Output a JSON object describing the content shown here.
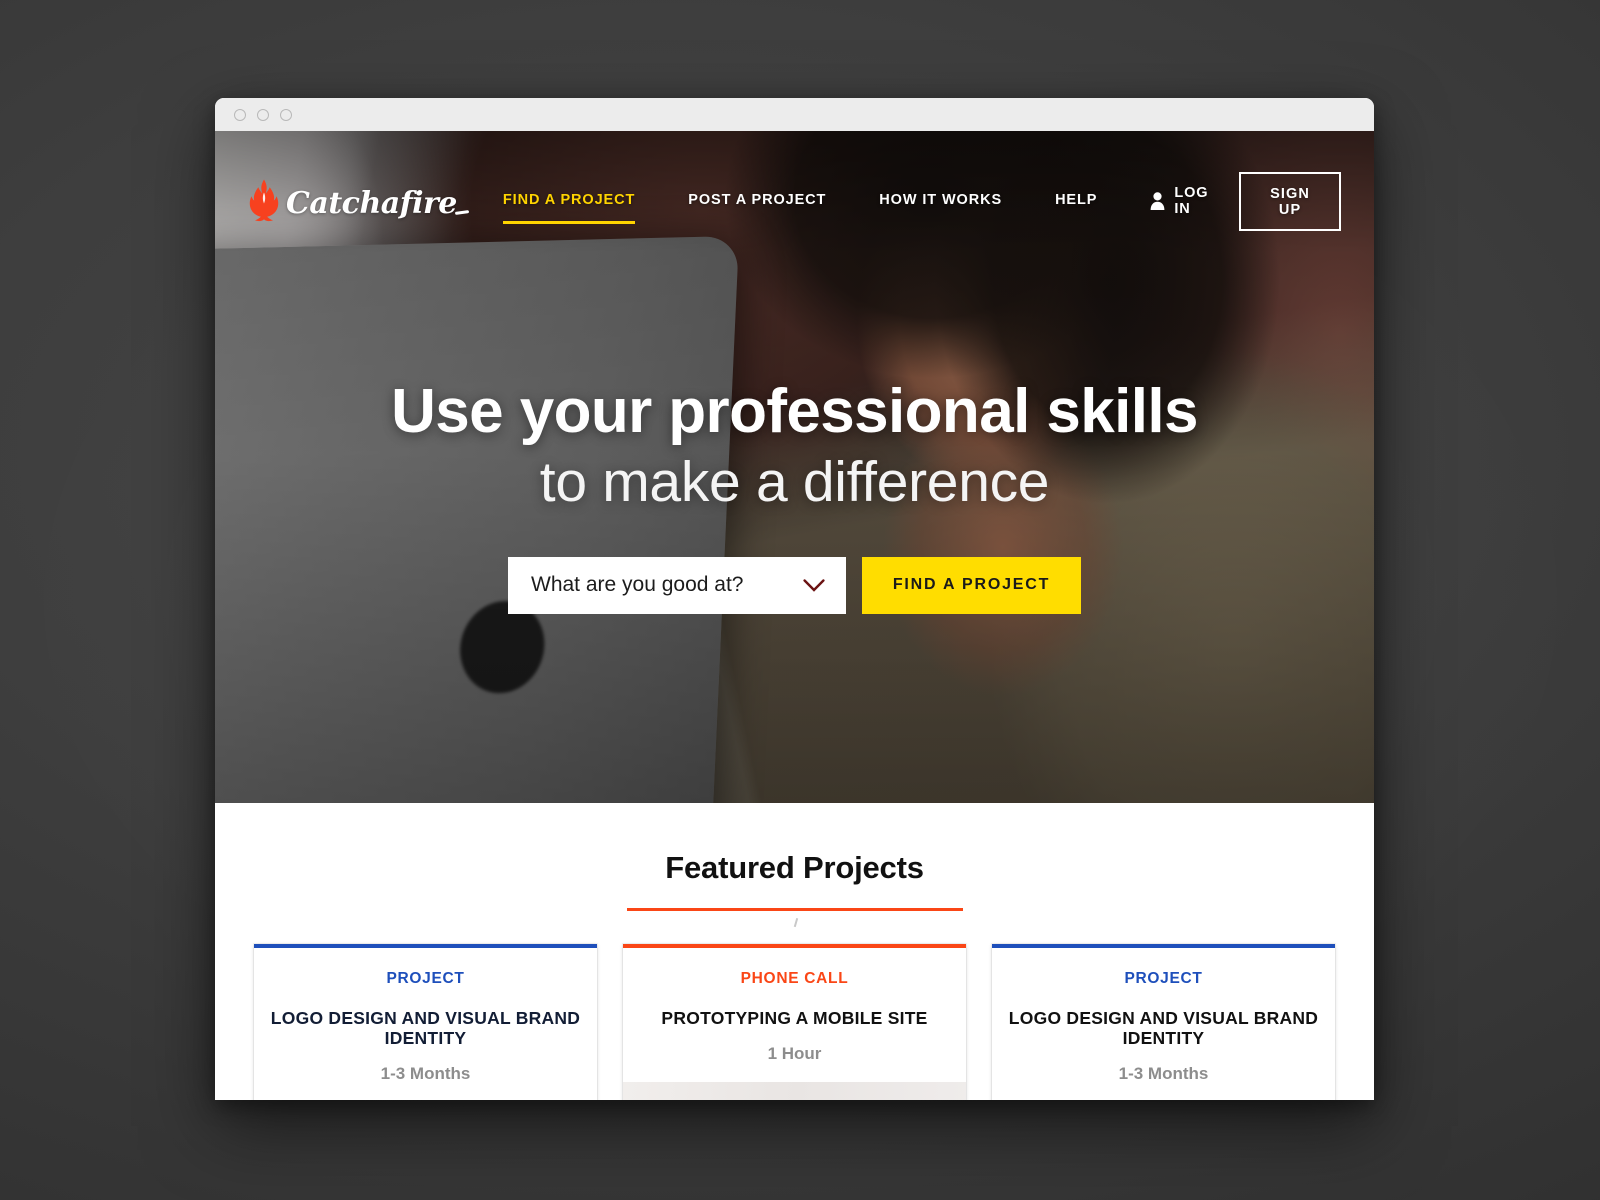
{
  "window": {
    "dots": [
      "close-dot",
      "minimize-dot",
      "maximize-dot"
    ]
  },
  "brand": {
    "name": "Catchafire",
    "flame_color": "#f7411f",
    "logo_text_color": "#ffffff"
  },
  "nav": {
    "links": [
      {
        "label": "FIND A PROJECT",
        "active": true
      },
      {
        "label": "POST A PROJECT",
        "active": false
      },
      {
        "label": "HOW IT WORKS",
        "active": false
      },
      {
        "label": "HELP",
        "active": false
      }
    ],
    "login_label": "LOG IN",
    "signup_label": "SIGN UP",
    "active_color": "#ffd400"
  },
  "hero": {
    "headline": "Use your professional skills",
    "subhead": "to make a difference",
    "select_value": "What are you good at?",
    "select_placeholder": "What are you good at?",
    "cta_label": "FIND A PROJECT",
    "cta_color": "#ffdd00"
  },
  "featured": {
    "title": "Featured Projects",
    "rule_color": "#fa4616",
    "cards": [
      {
        "kicker": "PROJECT",
        "title": "LOGO DESIGN AND VISUAL BRAND IDENTITY",
        "duration": "1-3 Months",
        "accent": "#1e4fbb"
      },
      {
        "kicker": "PHONE CALL",
        "title": "PROTOTYPING A MOBILE SITE",
        "duration": "1 Hour",
        "accent": "#fa4616"
      },
      {
        "kicker": "PROJECT",
        "title": "LOGO DESIGN AND VISUAL BRAND IDENTITY",
        "duration": "1-3 Months",
        "accent": "#1e4fbb"
      }
    ]
  }
}
